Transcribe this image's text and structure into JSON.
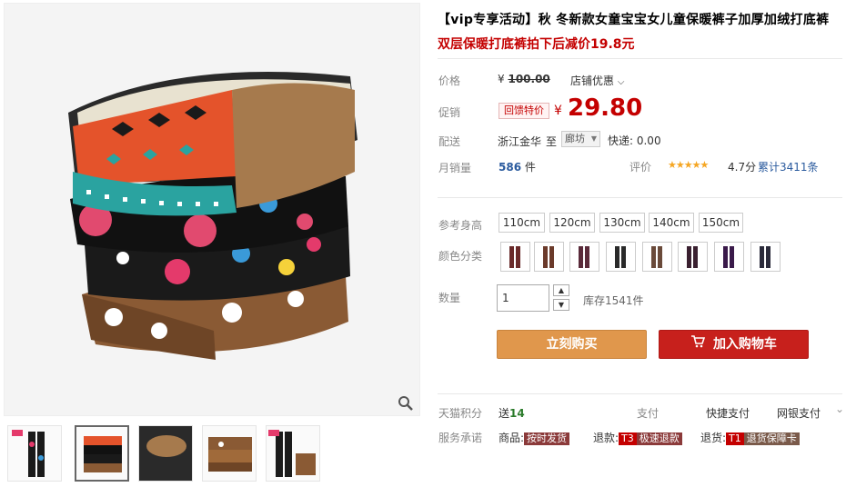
{
  "product": {
    "title": "【vip专享活动】秋 冬新款女童宝宝女儿童保暖裤子加厚加绒打底裤",
    "subtitle": "双层保暖打底裤拍下后减价19.8元"
  },
  "price": {
    "label": "价格",
    "original_prefix": "¥",
    "original": "100.00",
    "shop_discount": "店铺优惠",
    "chevron": "⌵"
  },
  "promo": {
    "label": "促销",
    "tag": "回馈特价",
    "currency": "¥",
    "price": "29.80"
  },
  "shipping": {
    "label": "配送",
    "from": "浙江金华",
    "to_word": "至",
    "to": "廊坊",
    "fee": "快递: 0.00"
  },
  "sales": {
    "label": "月销量",
    "count": "586",
    "unit": "件",
    "rating_label": "评价",
    "stars": "★★★★★",
    "score": "4.7分",
    "reviews": "累计3411条"
  },
  "options": {
    "size_label": "参考身高",
    "sizes": [
      "110cm",
      "120cm",
      "130cm",
      "140cm",
      "150cm"
    ],
    "color_label": "颜色分类",
    "swatch_colors": [
      "#6a2a2a",
      "#6b3a2a",
      "#5a2a3a",
      "#2a2a2a",
      "#6a4a3a",
      "#3a2030",
      "#3a1a4a",
      "#2a2a3a"
    ]
  },
  "quantity": {
    "label": "数量",
    "value": "1",
    "up": "▲",
    "down": "▼",
    "stock": "库存1541件"
  },
  "actions": {
    "buy_now": "立刻购买",
    "add_cart": "加入购物车"
  },
  "tmall": {
    "points_label": "天猫积分",
    "points_prefix": "送",
    "points": "14",
    "pay_label": "支付",
    "quick_pay": "快捷支付",
    "bank_pay": "网银支付",
    "more": "⌄"
  },
  "service": {
    "label": "服务承诺",
    "goods_prefix": "商品:",
    "goods_tag": "按时发货",
    "refund_prefix": "退款:",
    "refund_code": "T3",
    "refund_tag": "极速退款",
    "return_prefix": "退货:",
    "return_code": "T1",
    "return_tag": "退货保障卡"
  },
  "icons": {
    "zoom": "magnifier-icon",
    "cart": "cart-icon"
  }
}
